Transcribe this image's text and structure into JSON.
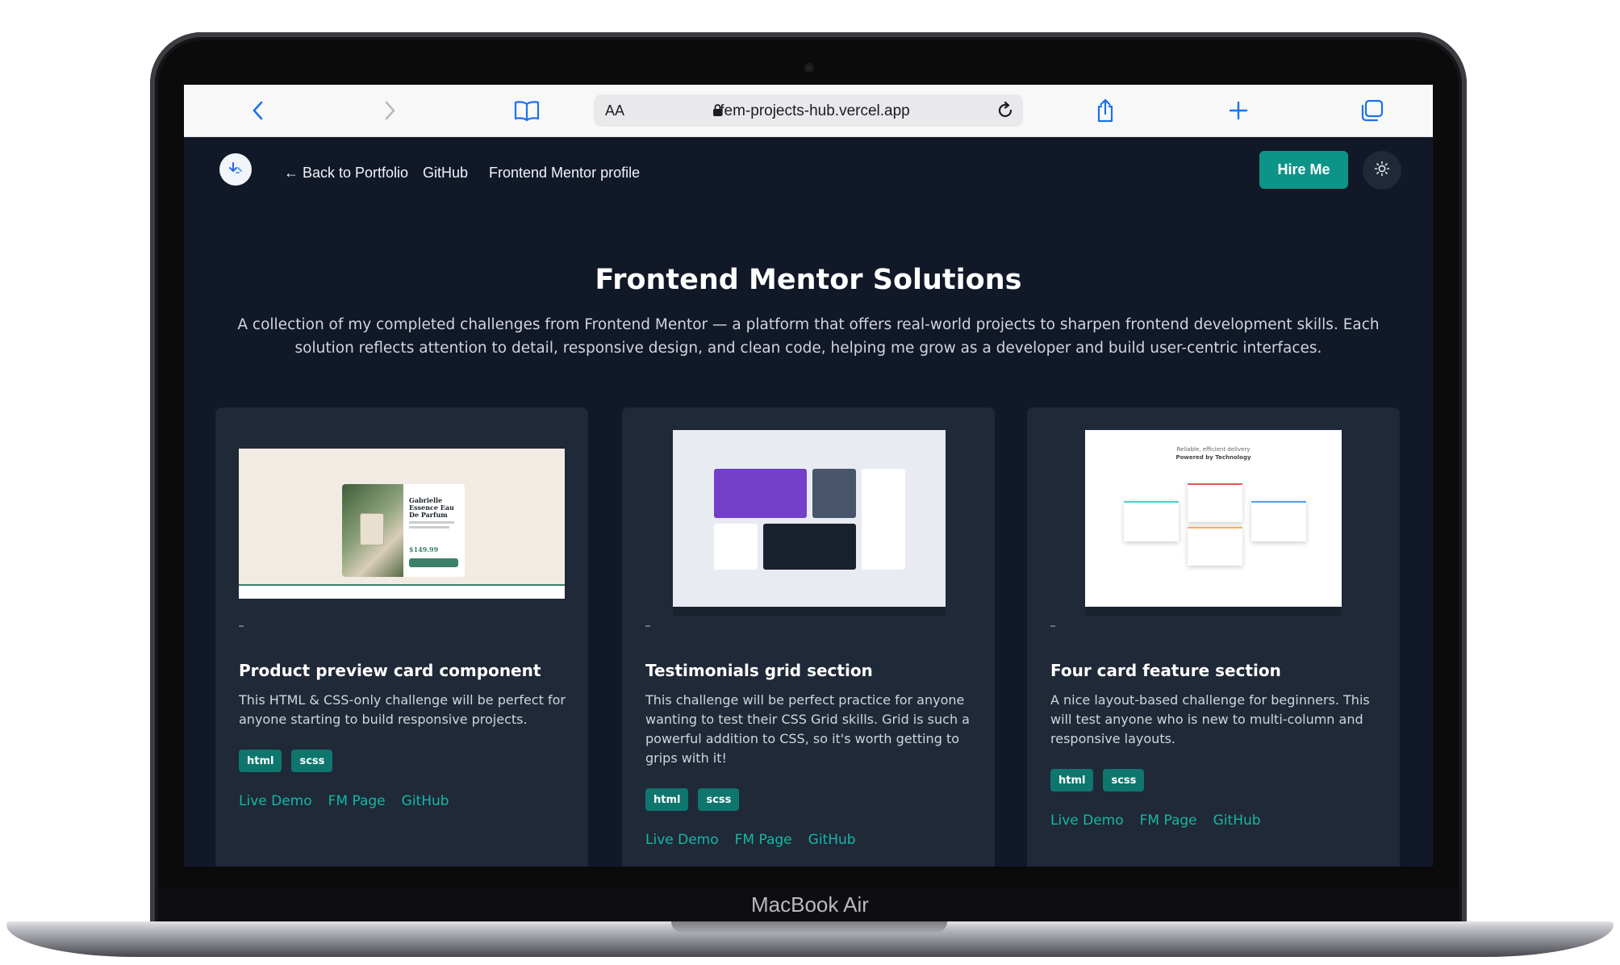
{
  "device": {
    "brand": "MacBook Air"
  },
  "browser": {
    "text_size_label": "AA",
    "url": "fem-projects-hub.vercel.app",
    "icons": [
      "back-icon",
      "forward-icon",
      "bookmarks-icon",
      "lock-icon",
      "reload-icon",
      "share-icon",
      "new-tab-icon",
      "tabs-icon"
    ]
  },
  "header": {
    "nav": [
      {
        "label": "← Back to Portfolio"
      },
      {
        "label": "GitHub"
      },
      {
        "label": "Frontend Mentor profile"
      }
    ],
    "hire_label": "Hire Me",
    "theme_icon": "sun-icon"
  },
  "hero": {
    "title": "Frontend Mentor Solutions",
    "description": "A collection of my completed challenges from Frontend Mentor — a platform that offers real-world projects to sharpen frontend development skills. Each solution reflects attention to detail, responsive design, and clean code, helping me grow as a developer and build user-centric interfaces."
  },
  "cards": [
    {
      "title": "Product preview card component",
      "description": "This HTML & CSS-only challenge will be perfect for anyone starting to build responsive projects.",
      "tags": [
        "html",
        "scss"
      ],
      "links": [
        "Live Demo",
        "FM Page",
        "GitHub"
      ],
      "thumb": {
        "product_name": "Gabrielle Essence Eau De Parfum",
        "price": "$149.99"
      }
    },
    {
      "title": "Testimonials grid section",
      "description": "This challenge will be perfect practice for anyone wanting to test their CSS Grid skills. Grid is such a powerful addition to CSS, so it's worth getting to grips with it!",
      "tags": [
        "html",
        "scss"
      ],
      "links": [
        "Live Demo",
        "FM Page",
        "GitHub"
      ]
    },
    {
      "title": "Four card feature section",
      "description": "A nice layout-based challenge for beginners. This will test anyone who is new to multi-column and responsive layouts.",
      "tags": [
        "html",
        "scss"
      ],
      "links": [
        "Live Demo",
        "FM Page",
        "GitHub"
      ],
      "thumb": {
        "heading_top": "Reliable, efficient delivery",
        "heading_bottom": "Powered by Technology"
      }
    }
  ],
  "colors": {
    "page_bg": "#111827",
    "card_bg": "#1f2937",
    "accent": "#0d9488",
    "link": "#14b8a6",
    "tag": "#0f766e"
  }
}
